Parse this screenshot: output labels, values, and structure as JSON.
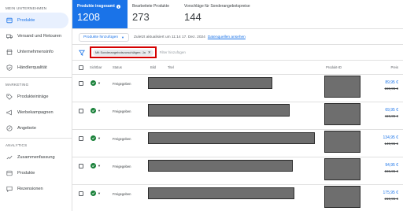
{
  "sidebar": {
    "sections": [
      {
        "title": "MEIN UNTERNEHMEN",
        "items": [
          {
            "label": "Produkte",
            "icon": "product-box-icon",
            "active": true
          },
          {
            "label": "Versand und Retouren",
            "icon": "truck-icon"
          },
          {
            "label": "Unternehmensinfo",
            "icon": "store-icon"
          },
          {
            "label": "Händlerqualität",
            "icon": "shield-check-icon"
          }
        ]
      },
      {
        "title": "MARKETING",
        "items": [
          {
            "label": "Produkteinträge",
            "icon": "tag-icon"
          },
          {
            "label": "Werbekampagnen",
            "icon": "megaphone-icon"
          },
          {
            "label": "Angebote",
            "icon": "offer-icon"
          }
        ]
      },
      {
        "title": "ANALYTICS",
        "items": [
          {
            "label": "Zusammenfassung",
            "icon": "trend-icon"
          },
          {
            "label": "Produkte",
            "icon": "product-box-icon"
          },
          {
            "label": "Rezensionen",
            "icon": "review-icon"
          }
        ]
      }
    ]
  },
  "stats": [
    {
      "label": "Produkte insgesamt",
      "value": "1208",
      "active": true
    },
    {
      "label": "Bearbeitete Produkte",
      "value": "273"
    },
    {
      "label": "Vorschläge für Sonderangebotspreise",
      "value": "144"
    }
  ],
  "toolbar": {
    "add_label": "Produkte hinzufügen",
    "updated_text": "Zuletzt aktualisiert um 11:14 17. Dez. 2024",
    "link_text": "Datenquellen ansehen"
  },
  "filter": {
    "chip_label": "Mit Sonderangebotsvorschlägen: Ja",
    "placeholder": "Filter hinzufügen"
  },
  "table": {
    "headers": {
      "visible": "Sichtbar",
      "status": "Status",
      "image": "Bild",
      "title": "Titel",
      "product_id": "Produkt-ID",
      "price": "Preis"
    },
    "rows": [
      {
        "status": "Freigegeben",
        "price": "89,95 €",
        "old_price": "159,95 €"
      },
      {
        "status": "Freigegeben",
        "price": "69,95 €",
        "old_price": "119,95 €"
      },
      {
        "status": "Freigegeben",
        "price": "134,95 €",
        "old_price": "149,95 €"
      },
      {
        "status": "Freigegeben",
        "price": "94,95 €",
        "old_price": "159,95 €"
      },
      {
        "status": "Freigegeben",
        "price": "175,95 €",
        "old_price": "219,95 €"
      }
    ]
  },
  "colors": {
    "accent": "#1a73e8",
    "status_green": "#188038",
    "highlight_red": "#d50000"
  }
}
